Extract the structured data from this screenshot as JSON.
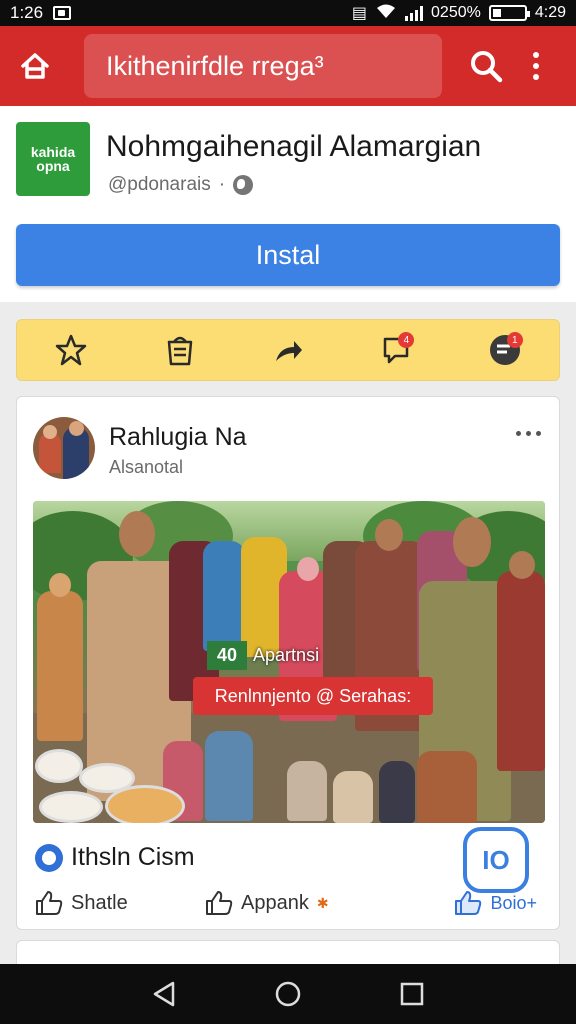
{
  "status_bar": {
    "time_left": "1:26",
    "battery_text": "0250%",
    "time_right": "4:29"
  },
  "app_bar": {
    "search_text": "Ikithenirfdle rrega³"
  },
  "app": {
    "logo_text": "kahida opna",
    "name": "Nohmgaihenagil Alamargian",
    "developer": "@pdonarais",
    "install_label": "Instal"
  },
  "action_bar": {
    "badges": [
      "4",
      "1"
    ]
  },
  "post": {
    "author": "Rahlugia Na",
    "subtitle": "Alsanotal",
    "image_number": "40",
    "image_caption": "Apartnsi",
    "image_banner": "Renlnnjento @ Serahas:",
    "title": "Ithsln Cism",
    "ig_label": "IO",
    "share_label": "Shatle",
    "approve_label": "Appank",
    "like_label": "Boio+"
  },
  "colors": {
    "app_bar": "#d32a2a",
    "install": "#3b82e4",
    "action_bar": "#fbdd73"
  }
}
